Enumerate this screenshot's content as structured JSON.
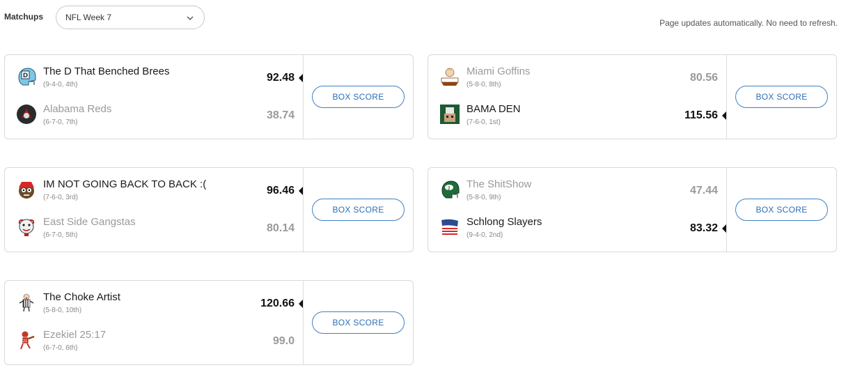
{
  "header": {
    "matchups_label": "Matchups",
    "week_select_value": "NFL Week 7",
    "auto_update_note": "Page updates automatically. No need to refresh."
  },
  "box_score_label": "BOX SCORE",
  "matchups": [
    {
      "team1": {
        "name": "The D That Benched Brees",
        "record": "(9-4-0, 4th)",
        "score": "92.48",
        "winner": true
      },
      "team2": {
        "name": "Alabama Reds",
        "record": "(6-7-0, 7th)",
        "score": "38.74",
        "winner": false
      }
    },
    {
      "team1": {
        "name": "Miami Goffins",
        "record": "(5-8-0, 8th)",
        "score": "80.56",
        "winner": false
      },
      "team2": {
        "name": "BAMA DEN",
        "record": "(7-6-0, 1st)",
        "score": "115.56",
        "winner": true
      }
    },
    {
      "team1": {
        "name": "IM NOT GOING BACK TO BACK :(",
        "record": "(7-6-0, 3rd)",
        "score": "96.46",
        "winner": true
      },
      "team2": {
        "name": "East Side Gangstas",
        "record": "(6-7-0, 5th)",
        "score": "80.14",
        "winner": false
      }
    },
    {
      "team1": {
        "name": "The ShitShow",
        "record": "(5-8-0, 9th)",
        "score": "47.44",
        "winner": false
      },
      "team2": {
        "name": "Schlong Slayers",
        "record": "(9-4-0, 2nd)",
        "score": "83.32",
        "winner": true
      }
    },
    {
      "team1": {
        "name": "The Choke Artist",
        "record": "(5-8-0, 10th)",
        "score": "120.66",
        "winner": true
      },
      "team2": {
        "name": "Ezekiel 25:17",
        "record": "(6-7-0, 6th)",
        "score": "99.0",
        "winner": false
      }
    }
  ]
}
